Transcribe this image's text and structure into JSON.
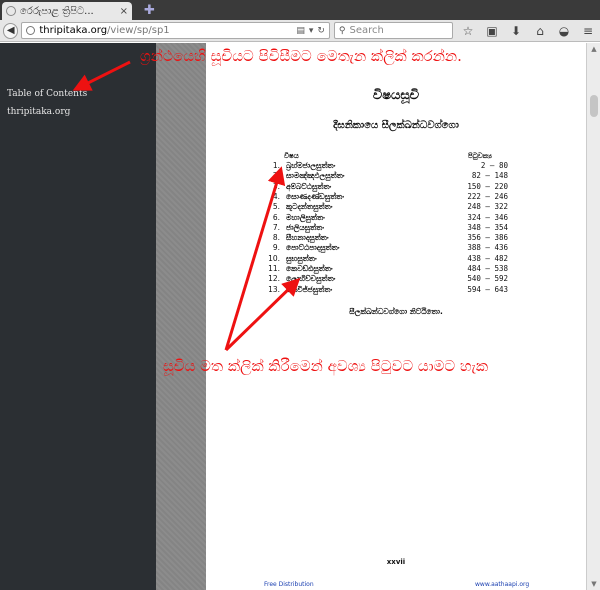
{
  "browser": {
    "tab_title": "රෙරුපාළ ත්‍රිපිට...",
    "tab_close": "×",
    "new_tab": "✚",
    "url_host": "thripitaka.org",
    "url_path": "/view/sp/sp1",
    "search_placeholder": "Search"
  },
  "sidebar": {
    "items": [
      {
        "label": "Table of Contents"
      },
      {
        "label": "thripitaka.org"
      }
    ]
  },
  "document": {
    "title": "විෂයසූචි",
    "subtitle": "දීඝනිකායෙ සීලක්ඛන්ධවග්ගො",
    "col_subject": "විෂය",
    "col_pages": "පිටුවක්‍ය",
    "toc": [
      {
        "num": "1.",
        "name": "බ්‍රහ්මජාලසුත්තං",
        "pages": "2 – 80"
      },
      {
        "num": "2.",
        "name": "සාමඤ්ඤඵලසුත්තං",
        "pages": "82 – 148"
      },
      {
        "num": "3.",
        "name": "අම්බට්ඨසුත්තං",
        "pages": "150 – 220"
      },
      {
        "num": "4.",
        "name": "සොණදණ්ඩසුත්තං",
        "pages": "222 – 246"
      },
      {
        "num": "5.",
        "name": "කූටදන්තසුත්තං",
        "pages": "248 – 322"
      },
      {
        "num": "6.",
        "name": "මහාලිසුත්තං",
        "pages": "324 – 346"
      },
      {
        "num": "7.",
        "name": "ජාලියසුත්තං",
        "pages": "348 – 354"
      },
      {
        "num": "8.",
        "name": "සීහනාදසුත්තං",
        "pages": "356 – 386"
      },
      {
        "num": "9.",
        "name": "පොට්ඨපාදසුත්තං",
        "pages": "388 – 436"
      },
      {
        "num": "10.",
        "name": "සුභසුත්තං",
        "pages": "438 – 482"
      },
      {
        "num": "11.",
        "name": "කෙවඩ්ඪසුත්තං",
        "pages": "484 – 538"
      },
      {
        "num": "12.",
        "name": "ලොහිච්චසුත්තං",
        "pages": "540 – 592"
      },
      {
        "num": "13.",
        "name": "තෙවිජ්ජසුත්තං",
        "pages": "594 – 643"
      }
    ],
    "ending": "සීලක්ඛන්ධවග්ගො නිට්ඨිතො.",
    "page_number": "xxvii",
    "footer_left": "Free Distribution",
    "footer_right": "www.aathaapi.org"
  },
  "annotations": {
    "top_note": "ග්‍රන්ථයෙහි සූචියට පිවිසීමට මෙතැන ක්ලික් කරන්න.",
    "middle_note": "සූචිය මත ක්ලික් කිරීමෙන් අවශ්‍ය පිටුවට යාමට හැක"
  },
  "colors": {
    "annotation_red": "#ee1111",
    "sidebar_bg": "#2b2f33",
    "link_blue": "#1a3fb0"
  }
}
